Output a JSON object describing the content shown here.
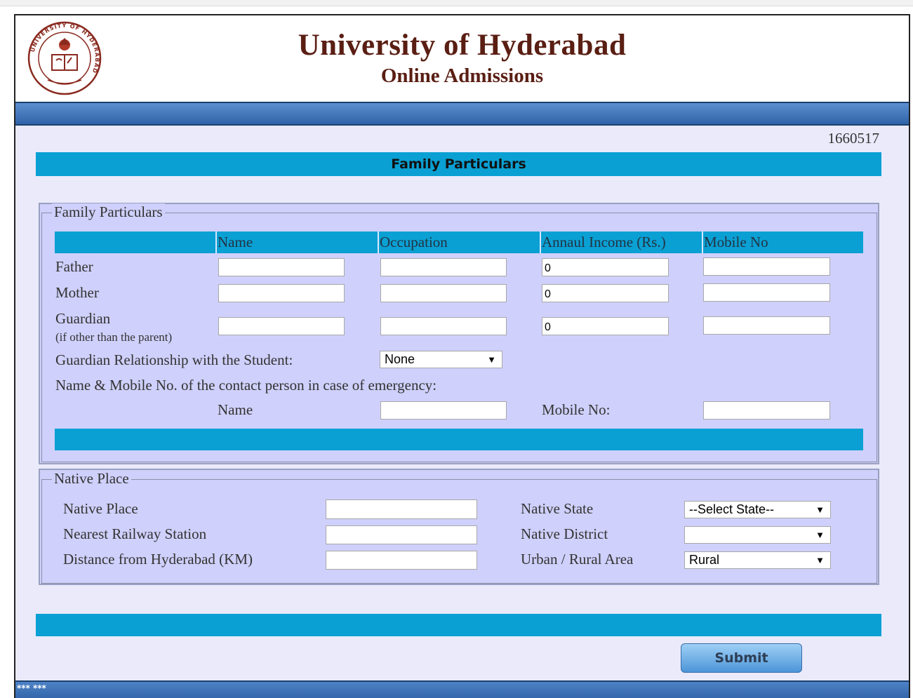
{
  "header": {
    "title": "University of Hyderabad",
    "subtitle": "Online Admissions",
    "logo_icon": "university-seal-logo",
    "logo_text": "UNIVERSITY OF HYDERABAD"
  },
  "application_number": "1660517",
  "section_title": "Family Particulars",
  "family": {
    "legend": "Family Particulars",
    "columns": [
      "Name",
      "Occupation",
      "Annaul Income (Rs.)",
      "Mobile No"
    ],
    "rows": {
      "father": {
        "label": "Father",
        "name": "",
        "occupation": "",
        "income": "0",
        "mobile": ""
      },
      "mother": {
        "label": "Mother",
        "name": "",
        "occupation": "",
        "income": "0",
        "mobile": ""
      },
      "guardian": {
        "label": "Guardian",
        "sublabel": "(if other than the parent)",
        "name": "",
        "occupation": "",
        "income": "0",
        "mobile": ""
      }
    },
    "guardian_relationship": {
      "label": "Guardian Relationship with the Student:",
      "selected": "None"
    },
    "emergency": {
      "label": "Name & Mobile No. of the contact person in case of emergency:",
      "name_label": "Name",
      "name_value": "",
      "mobile_label": "Mobile No:",
      "mobile_value": ""
    }
  },
  "native": {
    "legend": "Native Place",
    "native_place_label": "Native Place",
    "native_place_value": "",
    "railway_label": "Nearest Railway Station",
    "railway_value": "",
    "distance_label": "Distance from Hyderabad (KM)",
    "distance_value": "",
    "state_label": "Native State",
    "state_selected": "--Select State--",
    "district_label": "Native District",
    "district_selected": "",
    "area_label": "Urban / Rural Area",
    "area_selected": "Rural"
  },
  "submit_label": "Submit",
  "footer_text": "*** ***",
  "colors": {
    "band": "#0aa0d3",
    "fieldset_bg": "#cfd0fb",
    "title": "#5a1e13",
    "nav": "#2f63a8"
  }
}
